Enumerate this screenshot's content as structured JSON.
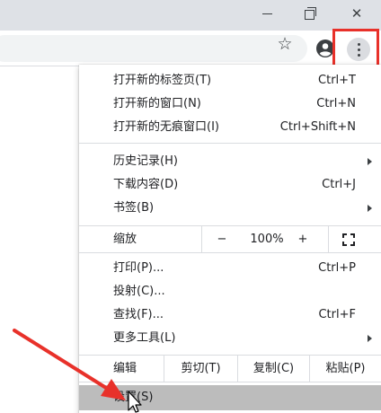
{
  "window": {
    "minimize_icon": "minimize-icon",
    "maximize_icon": "restore-icon",
    "close_icon": "close-icon",
    "close_glyph": "✕"
  },
  "toolbar": {
    "star_glyph": "☆",
    "star_icon": "bookmark-star-icon",
    "profile_icon": "account-icon",
    "menu_icon": "more-vertical-icon",
    "highlight_color": "#e8312a"
  },
  "menu": {
    "new_tab": {
      "label": "打开新的标签页(T)",
      "shortcut": "Ctrl+T"
    },
    "new_window": {
      "label": "打开新的窗口(N)",
      "shortcut": "Ctrl+N"
    },
    "new_incognito": {
      "label": "打开新的无痕窗口(I)",
      "shortcut": "Ctrl+Shift+N"
    },
    "history": {
      "label": "历史记录(H)"
    },
    "downloads": {
      "label": "下载内容(D)",
      "shortcut": "Ctrl+J"
    },
    "bookmarks": {
      "label": "书签(B)"
    },
    "zoom": {
      "label": "缩放",
      "minus": "−",
      "value": "100%",
      "plus": "+"
    },
    "print": {
      "label": "打印(P)...",
      "shortcut": "Ctrl+P"
    },
    "cast": {
      "label": "投射(C)..."
    },
    "find": {
      "label": "查找(F)...",
      "shortcut": "Ctrl+F"
    },
    "more_tools": {
      "label": "更多工具(L)"
    },
    "edit": {
      "label": "编辑",
      "cut": "剪切(T)",
      "copy": "复制(C)",
      "paste": "粘贴(P)"
    },
    "settings": {
      "label": "设置(S)"
    }
  },
  "annotation": {
    "arrow_color": "#e8312a"
  }
}
